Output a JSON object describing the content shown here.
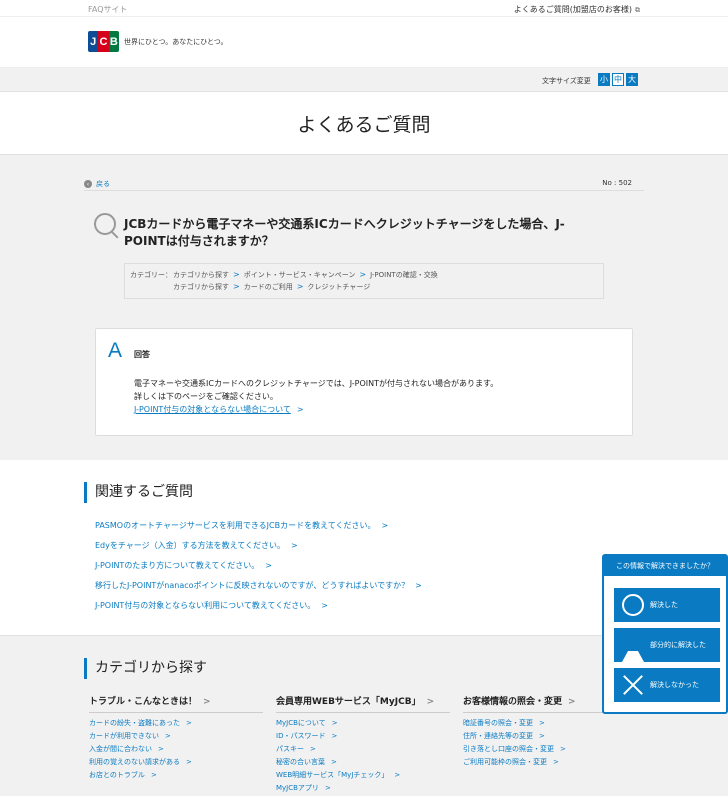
{
  "topbar": {
    "site": "FAQサイト",
    "merchant_link": "よくあるご質問(加盟店のお客様)"
  },
  "brand": {
    "logo_text": [
      "J",
      "C",
      "B"
    ],
    "tagline": "世界にひとつ。あなたにひとつ。"
  },
  "font_size": {
    "label": "文字サイズ変更",
    "small": "小",
    "medium": "中",
    "large": "大",
    "selected": "medium"
  },
  "page_title": "よくあるご質問",
  "question": {
    "back": "戻る",
    "number": "No : 502",
    "title": "JCBカードから電子マネーや交通系ICカードへクレジットチャージをした場合、J-POINTは付与されますか？",
    "category_label": "カテゴリー：",
    "category_paths": [
      [
        "カテゴリから探す",
        "ポイント・サービス・キャンペーン",
        "J-POINTの確認・交換"
      ],
      [
        "カテゴリから探す",
        "カードのご利用",
        "クレジットチャージ"
      ]
    ]
  },
  "answer": {
    "icon": "A",
    "label": "回答",
    "line1": "電子マネーや交通系ICカードへのクレジットチャージでは、J-POINTが付与されない場合があります。",
    "line2": "詳しくは下のページをご確認ください。",
    "link": "J-POINT付与の対象とならない場合について"
  },
  "related": {
    "title": "関連するご質問",
    "items": [
      "PASMOのオートチャージサービスを利用できるJCBカードを教えてください。",
      "Edyをチャージ（入金）する方法を教えてください。",
      "J-POINTのたまり方について教えてください。",
      "移行したJ-POINTがnanacoポイントに反映されないのですが、どうすればよいですか？",
      "J-POINT付与の対象とならない利用について教えてください。"
    ]
  },
  "categories": {
    "title": "カテゴリから探す",
    "columns": [
      {
        "heading": "トラブル・こんなときは！",
        "items": [
          "カードの紛失・盗難にあった",
          "カードが利用できない",
          "入金が間に合わない",
          "利用の覚えのない請求がある",
          "お店とのトラブル"
        ]
      },
      {
        "heading": "会員専用WEBサービス「MyJCB」",
        "items": [
          "MyJCBについて",
          "ID・パスワード",
          "パスキー",
          "秘密の合い言葉",
          "WEB明細サービス「MyJチェック」",
          "MyJCBアプリ"
        ]
      },
      {
        "heading": "お客様情報の照会・変更",
        "items": [
          "暗証番号の照会・変更",
          "住所・連絡先等の変更",
          "引き落とし口座の照会・変更",
          "ご利用可能枠の照会・変更"
        ]
      }
    ]
  },
  "survey": {
    "title": "この情報で解決できましたか？",
    "options": [
      "解決した",
      "部分的に解決した",
      "解決しなかった"
    ],
    "icons": [
      "circle-icon",
      "triangle-icon",
      "cross-icon"
    ]
  },
  "colors": {
    "accent": "#0a7bc2"
  }
}
